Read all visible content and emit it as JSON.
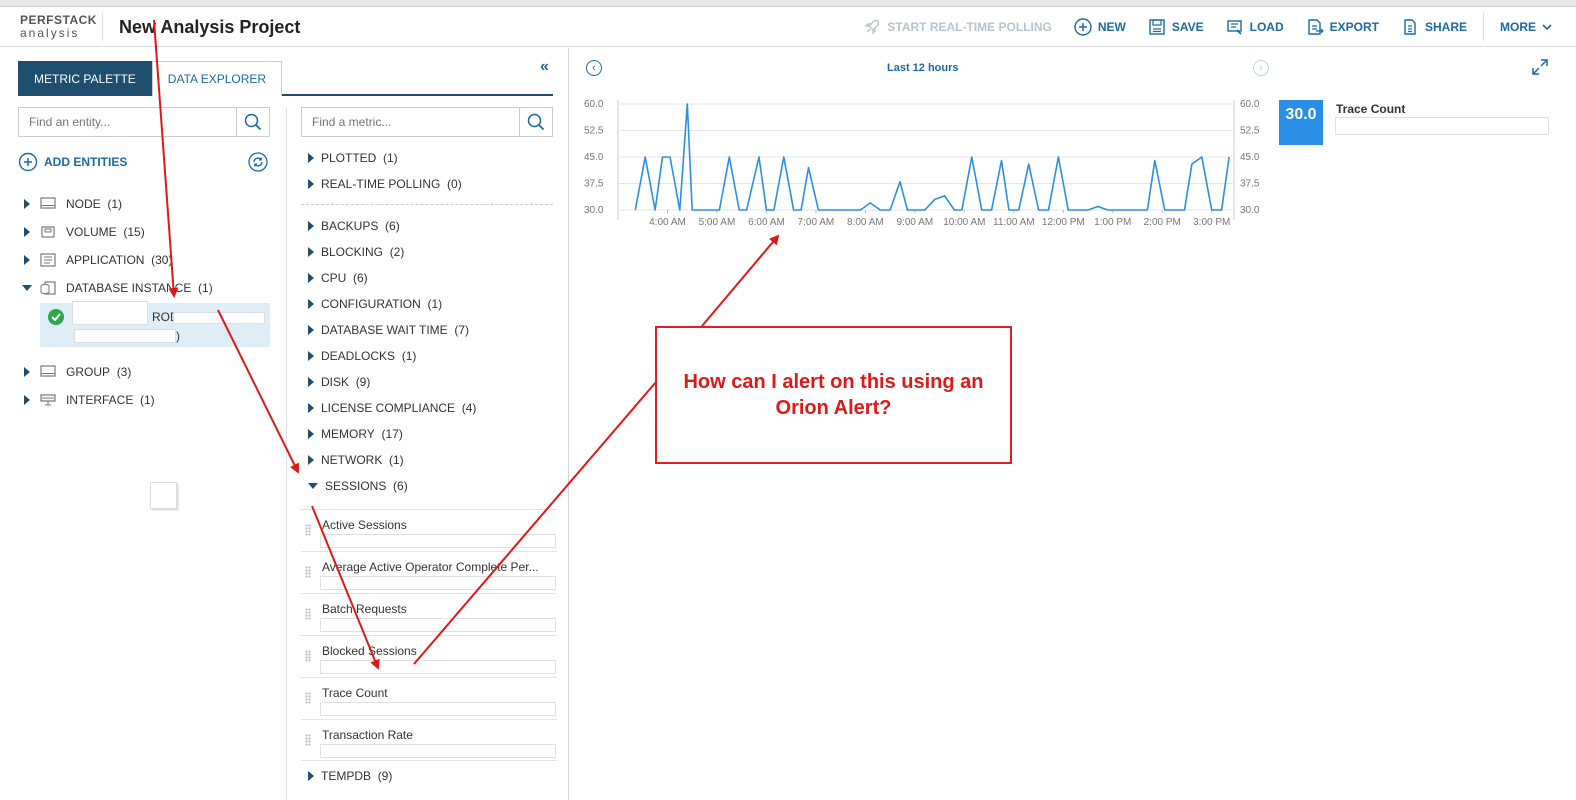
{
  "header": {
    "logo_line1": "PERFSTACK",
    "logo_line2": "analysis",
    "title": "New Analysis Project",
    "toolbar": {
      "start_polling": "START REAL-TIME POLLING",
      "new": "NEW",
      "save": "SAVE",
      "load": "LOAD",
      "export": "EXPORT",
      "share": "SHARE",
      "more": "MORE"
    }
  },
  "tabs": {
    "metric_palette": "METRIC PALETTE",
    "data_explorer": "DATA EXPLORER"
  },
  "entity_search": {
    "placeholder": "Find an entity..."
  },
  "metric_search": {
    "placeholder": "Find a metric..."
  },
  "add_entities": "ADD ENTITIES",
  "entities": [
    {
      "label": "NODE",
      "count": "(1)",
      "icon": "node-icon"
    },
    {
      "label": "VOLUME",
      "count": "(15)",
      "icon": "volume-icon"
    },
    {
      "label": "APPLICATION",
      "count": "(30)",
      "icon": "application-icon"
    },
    {
      "label": "DATABASE INSTANCE",
      "count": "(1)",
      "icon": "database-icon",
      "expanded": true
    },
    {
      "label": "GROUP",
      "count": "(3)",
      "icon": "group-icon"
    },
    {
      "label": "INTERFACE",
      "count": "(1)",
      "icon": "interface-icon"
    }
  ],
  "selected_entity": {
    "name_fragment": "ROD (",
    "name_tail": ")"
  },
  "metric_groups_top": [
    {
      "label": "PLOTTED",
      "count": "(1)"
    },
    {
      "label": "REAL-TIME POLLING",
      "count": "(0)"
    }
  ],
  "metric_categories": [
    {
      "label": "BACKUPS",
      "count": "(6)"
    },
    {
      "label": "BLOCKING",
      "count": "(2)"
    },
    {
      "label": "CPU",
      "count": "(6)"
    },
    {
      "label": "CONFIGURATION",
      "count": "(1)"
    },
    {
      "label": "DATABASE WAIT TIME",
      "count": "(7)"
    },
    {
      "label": "DEADLOCKS",
      "count": "(1)"
    },
    {
      "label": "DISK",
      "count": "(9)"
    },
    {
      "label": "LICENSE COMPLIANCE",
      "count": "(4)"
    },
    {
      "label": "MEMORY",
      "count": "(17)"
    },
    {
      "label": "NETWORK",
      "count": "(1)"
    },
    {
      "label": "SESSIONS",
      "count": "(6)",
      "expanded": true
    }
  ],
  "session_metrics": [
    "Active Sessions",
    "Average Active Operator Complete Per...",
    "Batch Requests",
    "Blocked Sessions",
    "Trace Count",
    "Transaction Rate"
  ],
  "tempdb": {
    "label": "TEMPDB",
    "count": "(9)"
  },
  "chart": {
    "time_range": "Last 12 hours",
    "legend_value": "30.0",
    "legend_name": "Trace Count"
  },
  "chart_data": {
    "type": "line",
    "title": "",
    "ylim": [
      30.0,
      60.0
    ],
    "y_ticks": [
      "60.0",
      "52.5",
      "45.0",
      "37.5",
      "30.0"
    ],
    "x_ticks": [
      "4:00 AM",
      "5:00 AM",
      "6:00 AM",
      "7:00 AM",
      "8:00 AM",
      "9:00 AM",
      "10:00 AM",
      "11:00 AM",
      "12:00 PM",
      "1:00 PM",
      "2:00 PM",
      "3:00 PM"
    ],
    "x_hours": [
      3.35,
      3.55,
      3.75,
      3.9,
      4.05,
      4.25,
      4.4,
      4.5,
      4.65,
      4.85,
      5.05,
      5.25,
      5.45,
      5.6,
      5.85,
      6.0,
      6.15,
      6.35,
      6.55,
      6.7,
      6.85,
      7.05,
      7.25,
      7.5,
      7.7,
      7.9,
      8.1,
      8.3,
      8.5,
      8.7,
      8.85,
      9.0,
      9.2,
      9.4,
      9.6,
      9.8,
      9.95,
      10.15,
      10.35,
      10.55,
      10.75,
      10.9,
      11.1,
      11.3,
      11.5,
      11.7,
      11.9,
      12.1,
      12.3,
      12.5,
      12.7,
      12.9,
      13.1,
      13.3,
      13.5,
      13.7,
      13.85,
      14.05,
      14.25,
      14.45,
      14.6,
      14.8,
      15.0,
      15.2,
      15.35
    ],
    "series": [
      {
        "color": "#2b8ee6",
        "values": [
          30,
          45,
          30,
          45,
          45,
          30,
          60,
          30,
          30,
          30,
          30,
          45,
          30,
          30,
          45,
          30,
          30,
          45,
          30,
          30,
          42,
          30,
          30,
          30,
          30,
          30,
          32,
          30,
          30,
          38,
          30,
          30,
          30,
          33,
          34,
          30,
          30,
          45,
          30,
          30,
          44,
          30,
          30,
          43,
          30,
          30,
          45,
          30,
          30,
          30,
          31,
          30,
          30,
          30,
          30,
          30,
          44,
          30,
          30,
          30,
          43,
          45,
          30,
          30,
          45
        ]
      }
    ]
  },
  "annotation": "How can I alert on this using an Orion Alert?"
}
